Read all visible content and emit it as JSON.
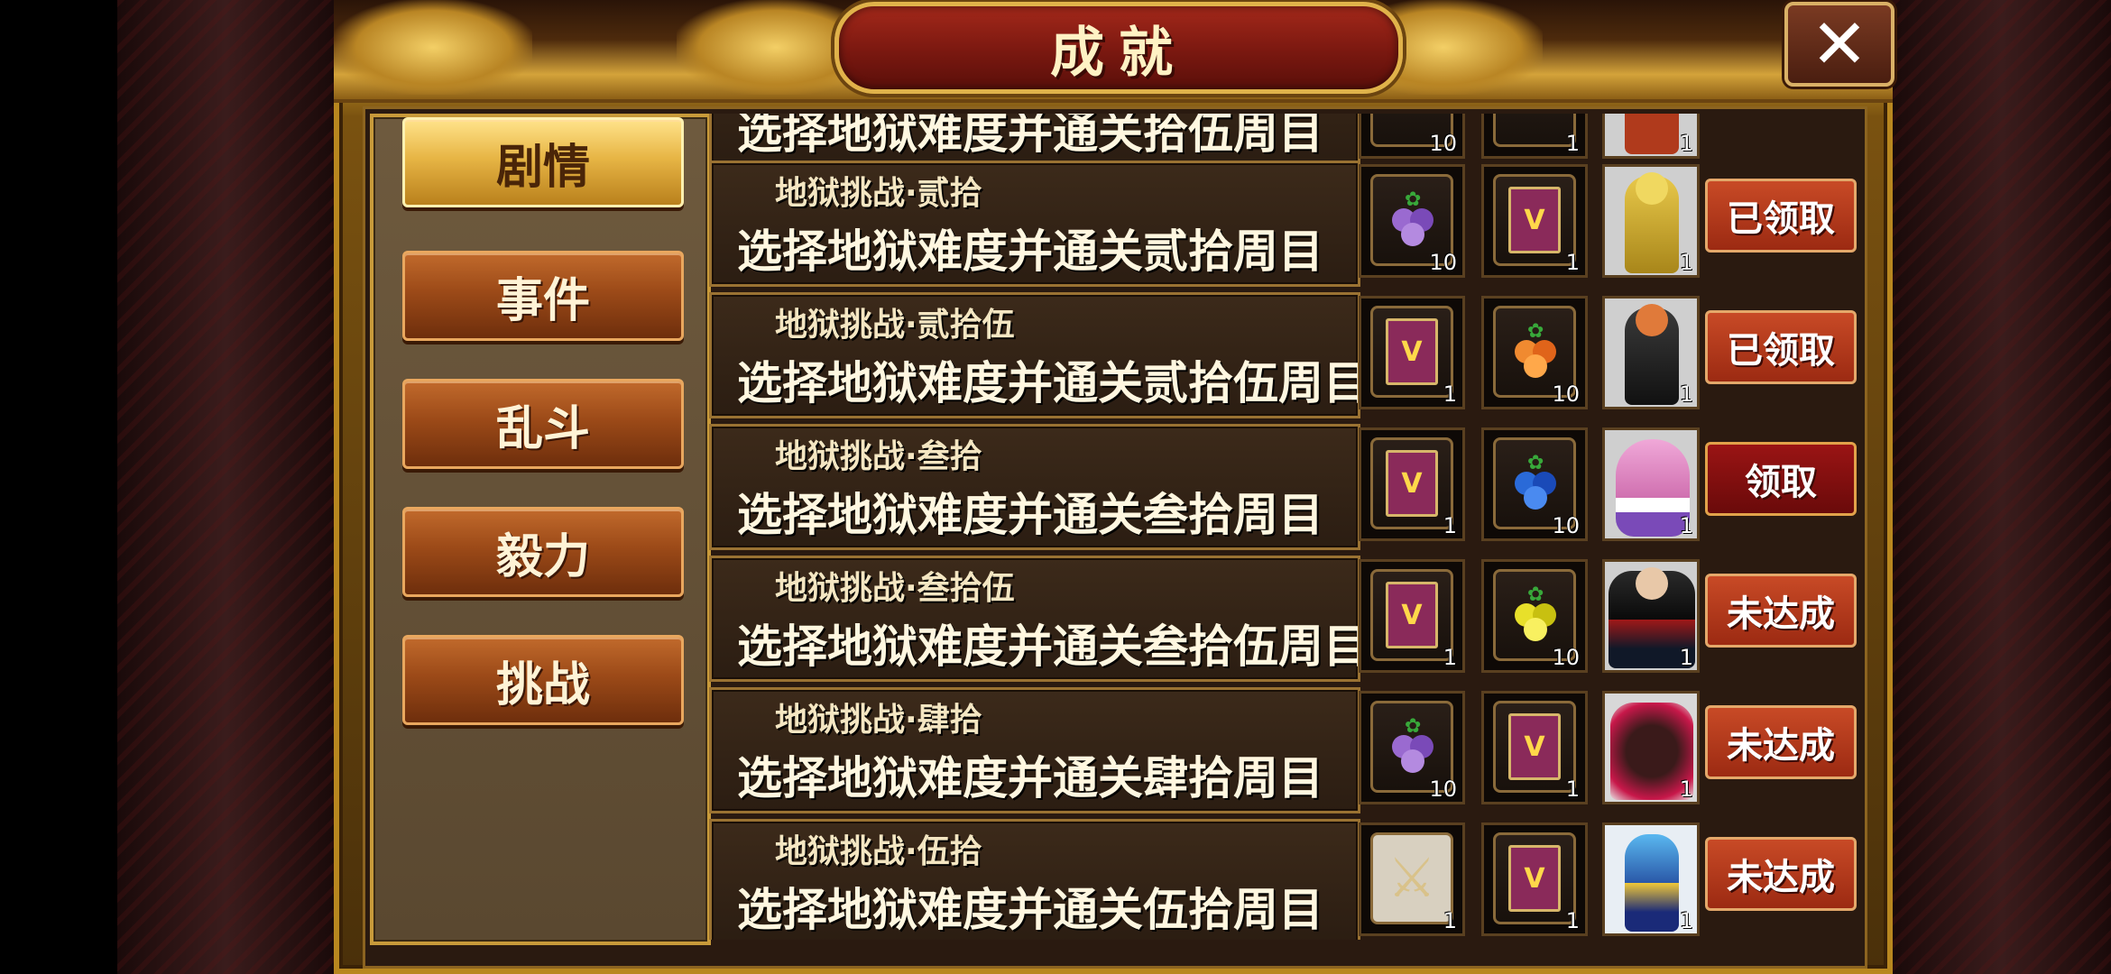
{
  "title": "成就",
  "close_icon": "close-icon",
  "sidebar": {
    "items": [
      {
        "label": "剧情",
        "active": true
      },
      {
        "label": "事件",
        "active": false
      },
      {
        "label": "乱斗",
        "active": false
      },
      {
        "label": "毅力",
        "active": false
      },
      {
        "label": "挑战",
        "active": false
      }
    ]
  },
  "rows": [
    {
      "title": "",
      "desc": "选择地狱难度并通关拾伍周目",
      "rewards": [
        {
          "icon": "fruit-icon",
          "count": "10"
        },
        {
          "icon": "book-icon",
          "count": "1"
        }
      ],
      "character": {
        "icon": "character-portrait",
        "count": "1"
      },
      "button": ""
    },
    {
      "title": "地狱挑战·贰拾",
      "desc": "选择地狱难度并通关贰拾周目",
      "rewards": [
        {
          "icon": "purple-fruit-icon",
          "count": "10"
        },
        {
          "icon": "book-icon",
          "count": "1"
        }
      ],
      "character": {
        "icon": "golden-armor-character",
        "count": "1"
      },
      "button": "已领取"
    },
    {
      "title": "地狱挑战·贰拾伍",
      "desc": "选择地狱难度并通关贰拾伍周目",
      "rewards": [
        {
          "icon": "book-icon",
          "count": "1"
        },
        {
          "icon": "orange-fruit-icon",
          "count": "10"
        }
      ],
      "character": {
        "icon": "dark-cloak-character",
        "count": "1"
      },
      "button": "已领取"
    },
    {
      "title": "地狱挑战·叁拾",
      "desc": "选择地狱难度并通关叁拾周目",
      "rewards": [
        {
          "icon": "book-icon",
          "count": "1"
        },
        {
          "icon": "blue-fruit-icon",
          "count": "10"
        }
      ],
      "character": {
        "icon": "pink-buu-character",
        "count": "1"
      },
      "button": "领取"
    },
    {
      "title": "地狱挑战·叁拾伍",
      "desc": "选择地狱难度并通关叁拾伍周目",
      "rewards": [
        {
          "icon": "book-icon",
          "count": "1"
        },
        {
          "icon": "yellow-fruit-icon",
          "count": "10"
        }
      ],
      "character": {
        "icon": "winged-dark-character",
        "count": "1"
      },
      "button": "未达成"
    },
    {
      "title": "地狱挑战·肆拾",
      "desc": "选择地狱难度并通关肆拾周目",
      "rewards": [
        {
          "icon": "purple-fruit-icon",
          "count": "10"
        },
        {
          "icon": "book-icon",
          "count": "1"
        }
      ],
      "character": {
        "icon": "red-aura-character",
        "count": "1"
      },
      "button": "未达成"
    },
    {
      "title": "地狱挑战·伍拾",
      "desc": "选择地狱难度并通关伍拾周目",
      "rewards": [
        {
          "icon": "crossed-weapons-icon",
          "count": "1"
        },
        {
          "icon": "book-icon",
          "count": "1"
        }
      ],
      "character": {
        "icon": "blue-hair-character",
        "count": "1"
      },
      "button": "未达成"
    }
  ],
  "colors": {
    "gold": "#e0b24a",
    "title_red": "#7a1810",
    "button_red": "#b03a1c",
    "active_tab": "#e7b545"
  }
}
